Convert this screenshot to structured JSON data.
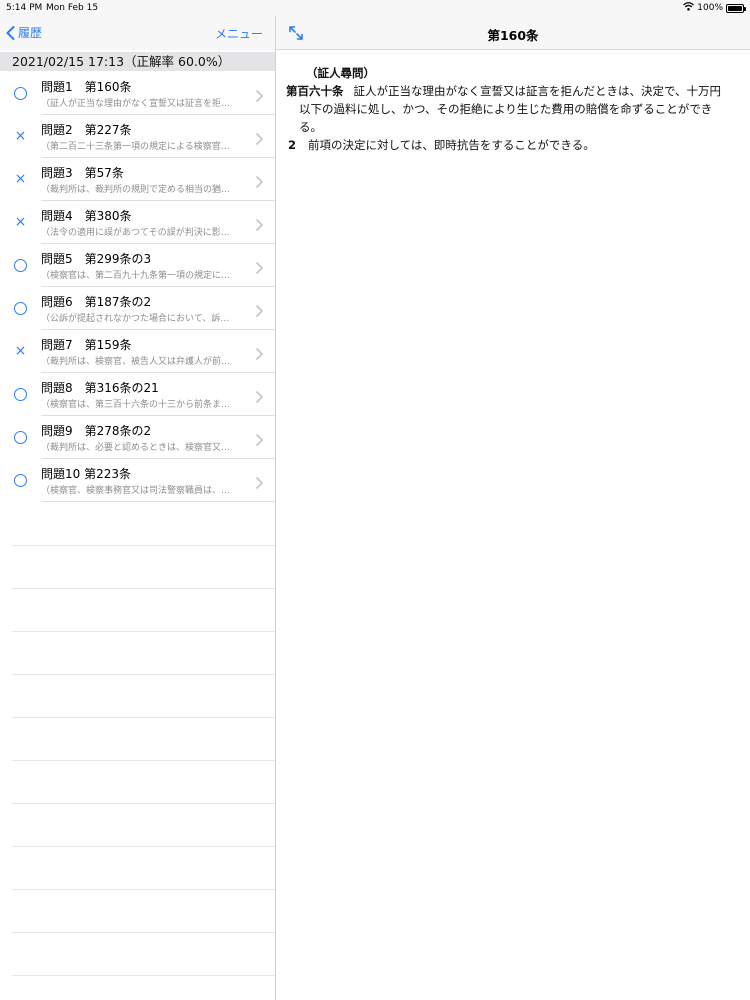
{
  "status_bar": {
    "time": "5:14 PM",
    "date": "Mon Feb 15",
    "battery": "100%",
    "battery_level": 1.0
  },
  "left_nav": {
    "back_label": "履歴",
    "menu_label": "メニュー"
  },
  "section_header": "2021/02/15 17:13（正解率 60.0%）",
  "questions": [
    {
      "result": "correct",
      "title": "問題1　第160条",
      "subtitle": "（証人が正当な理由がなく宣誓又は証言を拒…"
    },
    {
      "result": "incorrect",
      "title": "問題2　第227条",
      "subtitle": "（第二百二十三条第一項の規定による検察官…"
    },
    {
      "result": "incorrect",
      "title": "問題3　第57条",
      "subtitle": "（裁判所は、裁判所の規則で定める相当の猶…"
    },
    {
      "result": "incorrect",
      "title": "問題4　第380条",
      "subtitle": "（法令の適用に誤があつてその誤が判決に影…"
    },
    {
      "result": "correct",
      "title": "問題5　第299条の3",
      "subtitle": "（検察官は、第二百九十九条第一項の規定に…"
    },
    {
      "result": "correct",
      "title": "問題6　第187条の2",
      "subtitle": "（公訴が提起されなかつた場合において、訴…"
    },
    {
      "result": "incorrect",
      "title": "問題7　第159条",
      "subtitle": "（裁判所は、検察官、被告人又は弁護人が前…"
    },
    {
      "result": "correct",
      "title": "問題8　第316条の21",
      "subtitle": "（検察官は、第三百十六条の十三から前条ま…"
    },
    {
      "result": "correct",
      "title": "問題9　第278条の2",
      "subtitle": "（裁判所は、必要と認めるときは、検察官又…"
    },
    {
      "result": "correct",
      "title": "問題10 第223条",
      "subtitle": "（検察官、検察事務官又は司法警察職員は、…"
    }
  ],
  "result_marks": {
    "correct": "○",
    "incorrect": "×"
  },
  "right_nav": {
    "title": "第160条"
  },
  "article": {
    "caption": "（証人尋問）",
    "para1_number": "第百六十条",
    "para1_line1": "証人が正当な理由がなく宣誓又は証言を拒んだときは、決定で、十万円",
    "para1_line2": "以下の過料に処し、かつ、その拒絶により生じた費用の賠償を命ずることができ",
    "para1_line3": "る。",
    "para2_number": "2",
    "para2_text": "前項の決定に対しては、即時抗告をすることができる。"
  },
  "colors": {
    "accent": "#2f7cf6",
    "secondary_text": "#8e8e93",
    "section_bg": "#e4e4e6"
  },
  "icons": [
    "wifi-icon",
    "battery-icon",
    "chevron-left-icon",
    "chevron-right-icon",
    "expand-icon",
    "circle-icon",
    "cross-icon"
  ]
}
